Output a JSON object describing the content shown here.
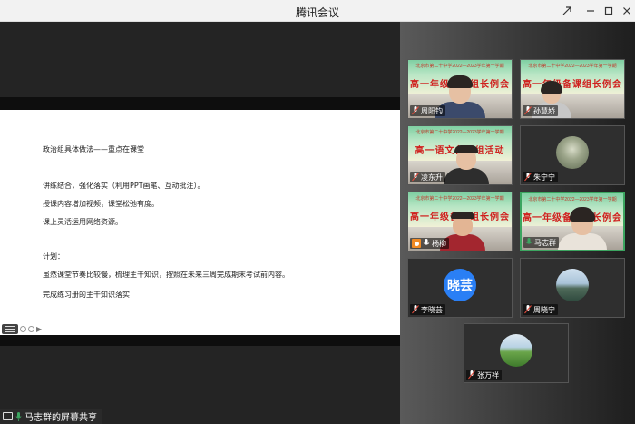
{
  "app": {
    "title": "腾讯会议"
  },
  "share": {
    "presenter_label": "马志群的屏幕共享",
    "doc_lines": [
      "政治组具体做法——重点在课堂",
      "讲练结合，强化落实（利用PPT画笔、互动批注）。",
      "授课内容增加视频，课堂松弛有度。",
      "课上灵活运用网络资源。",
      "计划：",
      "虽然课堂节奏比较慢，梳理主干知识，按照在未来三周完成期末考试前内容。",
      "完成练习册的主干知识落实"
    ]
  },
  "banners": {
    "school_line": "北京市第二十中学2022—2023学年第一学期",
    "meeting_a": "高一年级备课组长例会",
    "meeting_b": "高一语文备课组活动"
  },
  "participants": [
    {
      "name": "周阳钧"
    },
    {
      "name": "孙慧娇"
    },
    {
      "name": "凌东升"
    },
    {
      "name": "朱宁宁"
    },
    {
      "name": "杨柳"
    },
    {
      "name": "马志群"
    },
    {
      "name": "李晓芸",
      "avatar_text": "晓芸"
    },
    {
      "name": "周晓宁"
    },
    {
      "name": "张万祥"
    }
  ],
  "icons": {
    "mic_muted": "mic-muted-icon",
    "mic_active": "mic-icon",
    "screen_share": "screen-share-icon",
    "user": "user-icon"
  },
  "colors": {
    "speaking_border": "#3ca560",
    "banner_text": "#d0201e",
    "avatar_blue": "#2a7ff5"
  }
}
